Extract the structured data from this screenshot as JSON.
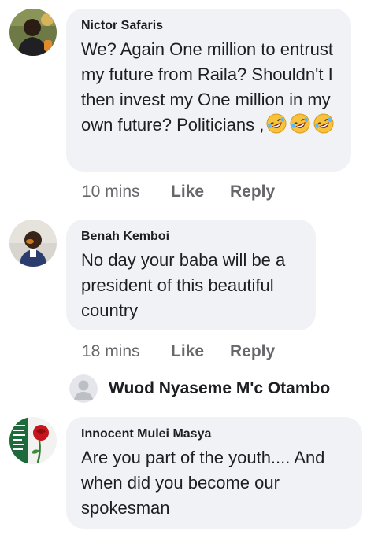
{
  "comments": [
    {
      "author": "Nictor Safaris",
      "text": "We? Again One million to entrust my future from Raila? Shouldn't I then invest my One million in my own future? Politicians ,",
      "emojis": [
        "rolling-on-floor-laughing-emoji",
        "rolling-on-floor-laughing-emoji",
        "rolling-on-floor-laughing-emoji"
      ],
      "time": "10 mins",
      "like_label": "Like",
      "reply_label": "Reply"
    },
    {
      "author": "Benah Kemboi",
      "text": "No day your baba will be a president of this beautiful country",
      "time": "18 mins",
      "like_label": "Like",
      "reply_label": "Reply"
    },
    {
      "author": "Innocent Mulei Masya",
      "text": "Are you part of the youth.... And when did you become our spokesman"
    }
  ],
  "reply_prompt": {
    "name": "Wuod Nyaseme M'c Otambo"
  },
  "colors": {
    "bubble_bg": "#f0f2f5",
    "meta_text": "#65676b",
    "text": "#1c1e21"
  }
}
